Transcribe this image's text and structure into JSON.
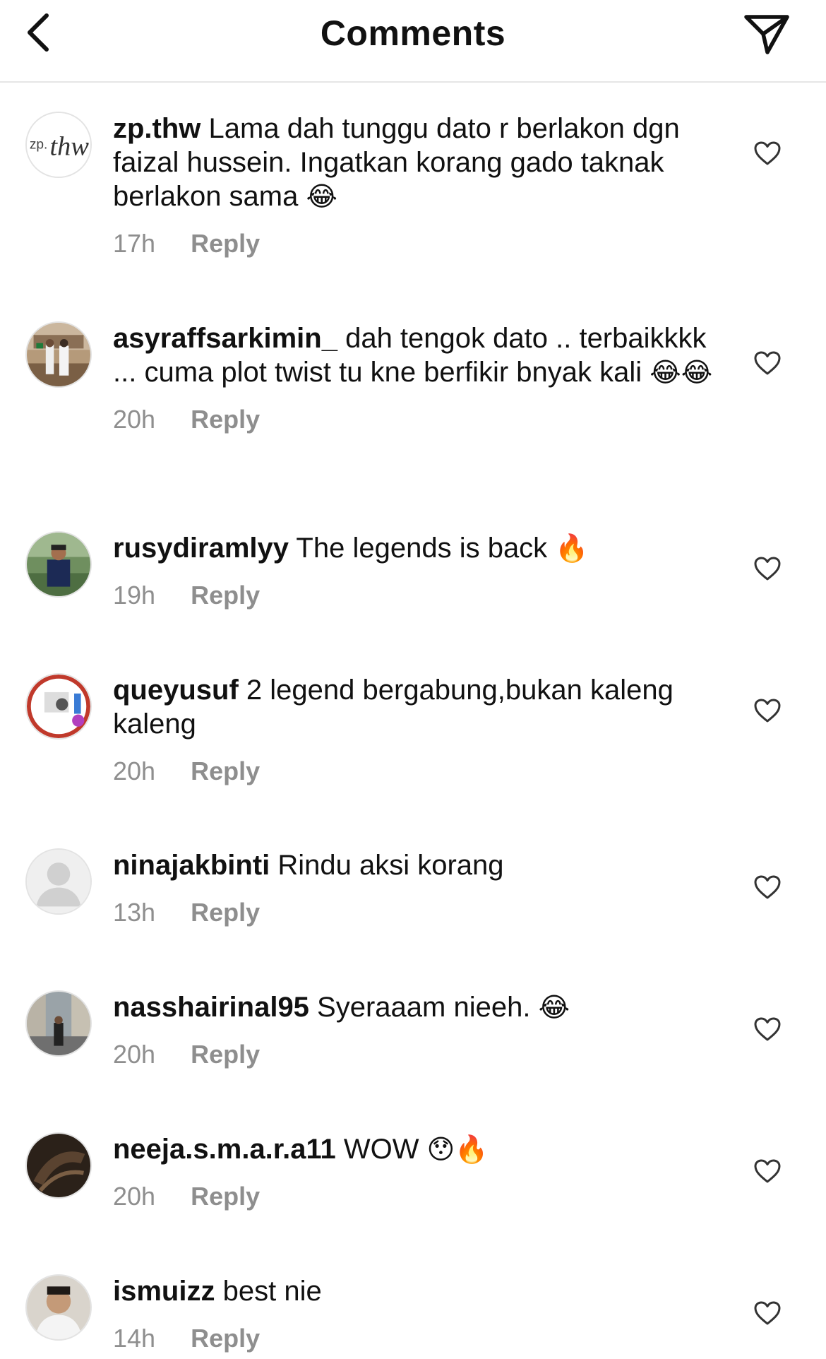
{
  "header": {
    "title": "Comments",
    "back_icon": "chevron-left-icon",
    "send_icon": "paper-plane-icon"
  },
  "comments": [
    {
      "username": "zp.thw",
      "text": " Lama dah tunggu dato r berlakon dgn faizal hussein. Ingatkan korang gado taknak berlakon sama ",
      "emoji": "😂",
      "time": "17h",
      "reply": "Reply"
    },
    {
      "username": "asyraffsarkimin_",
      "text": " dah tengok dato .. terbaikkkk ... cuma plot twist tu kne berfikir bnyak kali ",
      "emoji": "😂😂",
      "time": "20h",
      "reply": "Reply"
    },
    {
      "username": "rusydiramlyy",
      "text": " The legends is back ",
      "emoji": "🔥",
      "time": "19h",
      "reply": "Reply"
    },
    {
      "username": "queyusuf",
      "text": " 2 legend bergabung,bukan kaleng kaleng",
      "emoji": "",
      "time": "20h",
      "reply": "Reply"
    },
    {
      "username": "ninajakbinti",
      "text": " Rindu aksi korang",
      "emoji": "",
      "time": "13h",
      "reply": "Reply"
    },
    {
      "username": "nasshairinal95",
      "text": " Syeraaam nieeh. ",
      "emoji": "😂",
      "time": "20h",
      "reply": "Reply"
    },
    {
      "username": "neeja.s.m.a.r.a11",
      "text": " WOW ",
      "emoji": "😯🔥",
      "time": "20h",
      "reply": "Reply"
    },
    {
      "username": "ismuizz",
      "text": " best nie",
      "emoji": "",
      "time": "14h",
      "reply": "Reply"
    }
  ],
  "avatar_logo_text": "zp. thw",
  "colors": {
    "text": "#111111",
    "secondary": "#8e8e8e",
    "divider": "#e6e6e6"
  }
}
